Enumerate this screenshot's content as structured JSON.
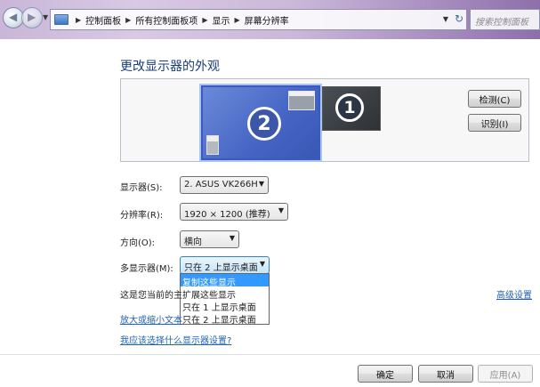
{
  "address_bar": {
    "breadcrumbs": [
      "控制面板",
      "所有控制面板项",
      "显示",
      "屏幕分辨率"
    ],
    "search_placeholder": "搜索控制面板"
  },
  "page_title": "更改显示器的外观",
  "monitors": {
    "primary_number": "2",
    "secondary_number": "1"
  },
  "buttons": {
    "detect": "检测(C)",
    "identify": "识别(I)",
    "ok": "确定",
    "cancel": "取消",
    "apply": "应用(A)"
  },
  "settings": {
    "display_label": "显示器(S):",
    "display_value": "2. ASUS VK266H",
    "resolution_label": "分辨率(R):",
    "resolution_value": "1920 × 1200 (推荐)",
    "orientation_label": "方向(O):",
    "orientation_value": "横向",
    "multi_display_label": "多显示器(M):",
    "multi_display_value": "只在 2 上显示桌面",
    "multi_display_options": [
      "复制这些显示",
      "扩展这些显示",
      "只在 1 上显示桌面",
      "只在 2 上显示桌面"
    ]
  },
  "partial_texts": {
    "current_main_prefix": "这是您当前的主",
    "enlarge_prefix": "放大或缩小文本"
  },
  "links": {
    "advanced": "高级设置",
    "which_setting": "我应该选择什么显示器设置?"
  },
  "colors": {
    "accent": "#3399ff",
    "link": "#1f63b3",
    "title": "#1a3e78"
  }
}
